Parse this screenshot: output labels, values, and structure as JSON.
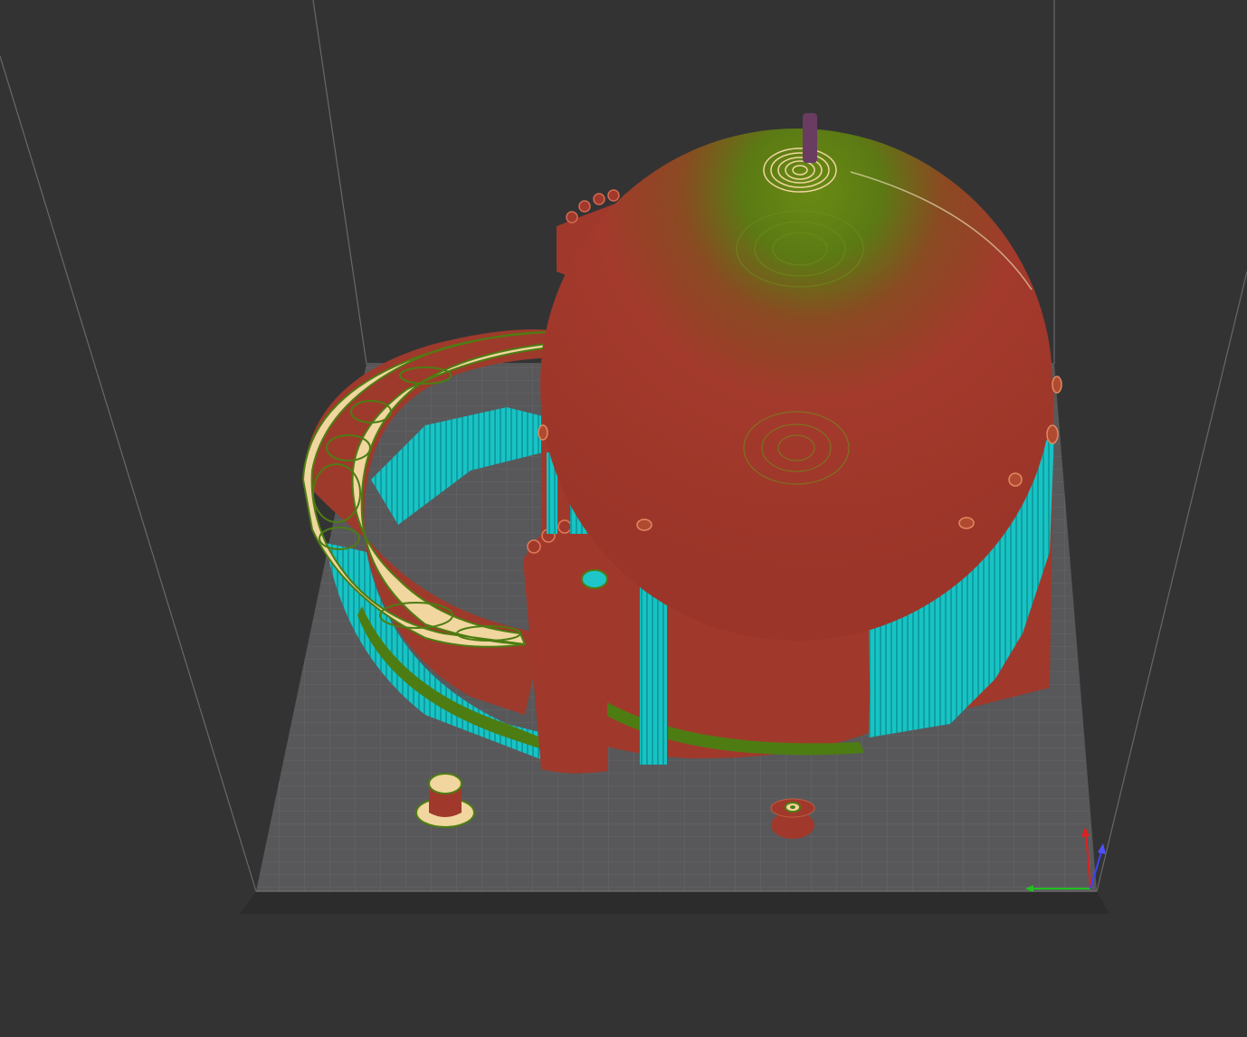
{
  "viewport": {
    "view": "3d-preview",
    "colors": {
      "background": "#333334",
      "build_volume_edge": "#6a6a6c",
      "bed_surface": "#5b5b5d",
      "bed_edge": "#2b2b2c",
      "bed_grid": "#676769",
      "perimeter": "#9e3a2c",
      "perimeter_dark": "#7f2a1f",
      "top_layer_green": "#4d7d12",
      "solid_infill": "#f1d6a0",
      "support": "#17c6c6",
      "support_dark": "#0e9a9c",
      "wipe_tower": "#6a3c62",
      "axis_x": "#e02020",
      "axis_y": "#20c020",
      "axis_z": "#4040ff"
    },
    "objects": [
      {
        "name": "dome-model",
        "features": [
          "perimeter",
          "top-layer",
          "support"
        ]
      },
      {
        "name": "ring-model",
        "features": [
          "perimeter",
          "solid-infill",
          "support"
        ]
      },
      {
        "name": "small-cylinder-part",
        "features": [
          "perimeter",
          "solid-infill"
        ]
      },
      {
        "name": "small-disc-part",
        "features": [
          "perimeter",
          "solid-infill"
        ]
      }
    ]
  }
}
